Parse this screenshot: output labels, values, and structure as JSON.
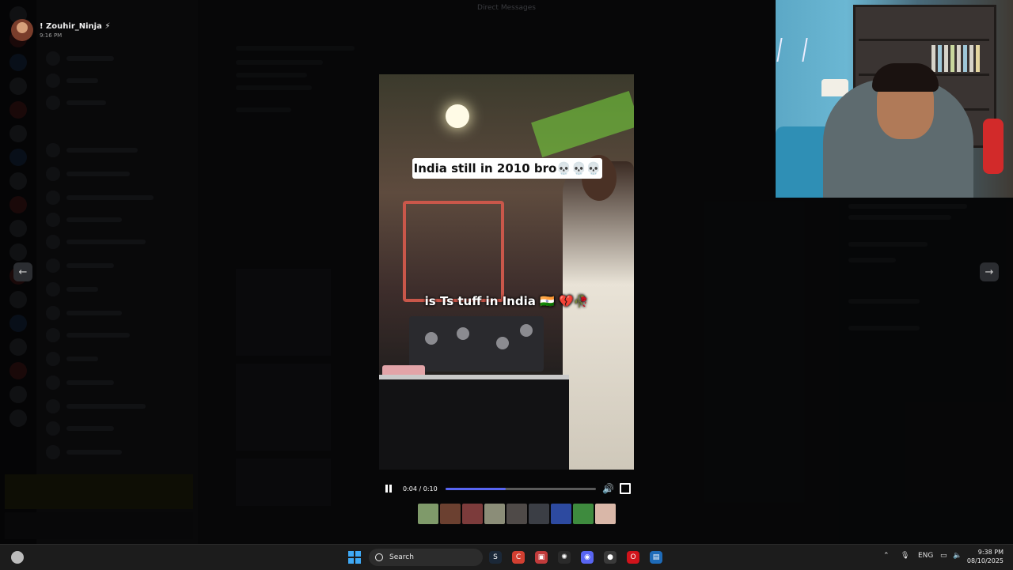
{
  "window": {
    "header_user": "! Zouhir_Ninja ⚡",
    "header_time": "9:16 PM",
    "top_caption": "Direct Messages"
  },
  "video": {
    "caption_top": "India still in 2010 bro💀💀💀",
    "caption_mid": "is Ts tuff in India 🇮🇳 💔🥀",
    "timecode": "0:04 / 0:10",
    "progress_fraction": 0.4,
    "accent_color": "#5865f2"
  },
  "nav": {
    "prev_icon": "←",
    "next_icon": "→"
  },
  "thumbnails": {
    "colors": [
      "#7f9a6a",
      "#6b4030",
      "#7c3b3b",
      "#8b8d78",
      "#4f4a48",
      "#3b3e45",
      "#2d4aa0",
      "#3e8b3e",
      "#d9b7a8"
    ]
  },
  "taskbar": {
    "search_label": "Search",
    "language": "ENG",
    "time": "9:38 PM",
    "date": "08/10/2025",
    "apps": [
      {
        "name": "steam-icon",
        "color": "#1b2838",
        "glyph": "S"
      },
      {
        "name": "chrome-icon",
        "color": "#d23f31",
        "glyph": "C"
      },
      {
        "name": "capture-icon",
        "color": "#c13b3b",
        "glyph": "▣"
      },
      {
        "name": "chatgpt-icon",
        "color": "#2a2a2a",
        "glyph": "✺"
      },
      {
        "name": "discord-icon",
        "color": "#5865f2",
        "glyph": "◉"
      },
      {
        "name": "obs-icon",
        "color": "#3a3a3a",
        "glyph": "●"
      },
      {
        "name": "opera-icon",
        "color": "#d0131b",
        "glyph": "O"
      },
      {
        "name": "window-app-icon",
        "color": "#1e6bb8",
        "glyph": "▤"
      }
    ]
  }
}
